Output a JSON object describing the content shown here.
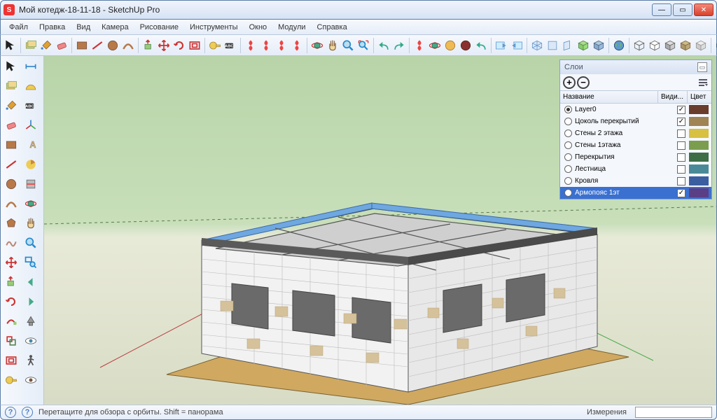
{
  "window": {
    "title": "Мой котедж-18-11-18 - SketchUp Pro"
  },
  "menu": [
    "Файл",
    "Правка",
    "Вид",
    "Камера",
    "Рисование",
    "Инструменты",
    "Окно",
    "Модули",
    "Справка"
  ],
  "layer_dropdown": {
    "current": "Layer0"
  },
  "layers_panel": {
    "title": "Слои",
    "columns": {
      "name": "Название",
      "visible": "Види...",
      "color": "Цвет"
    },
    "items": [
      {
        "name": "Layer0",
        "active": true,
        "visible": true,
        "color": "#6a3c2c"
      },
      {
        "name": "Цоколь перекрытий",
        "active": false,
        "visible": true,
        "color": "#a08454"
      },
      {
        "name": "Стены 2 этажа",
        "active": false,
        "visible": false,
        "color": "#d8c040"
      },
      {
        "name": "Стены 1этажа",
        "active": false,
        "visible": false,
        "color": "#7a9e4e"
      },
      {
        "name": "Перекрытия",
        "active": false,
        "visible": false,
        "color": "#3d6e46"
      },
      {
        "name": "Лестница",
        "active": false,
        "visible": false,
        "color": "#4a8a98"
      },
      {
        "name": "Кровля",
        "active": false,
        "visible": false,
        "color": "#3a5ea0"
      },
      {
        "name": "Армопояс 1эт",
        "active": false,
        "visible": true,
        "color": "#5a3e86",
        "selected": true
      }
    ]
  },
  "statusbar": {
    "hint": "Перетащите для обзора с орбиты.  Shift = панорама",
    "measure_label": "Измерения"
  },
  "toolbar_icons": [
    "select-arrow",
    "divider",
    "component",
    "paint-bucket",
    "eraser",
    "divider",
    "rectangle",
    "line",
    "circle",
    "arc",
    "divider",
    "push-pull",
    "move",
    "rotate",
    "offset",
    "divider",
    "measure",
    "text",
    "divider",
    "shape-red",
    "shape-red",
    "shape-red",
    "shape-red",
    "divider",
    "orbit",
    "pan",
    "zoom",
    "zoom-extents",
    "divider",
    "undo",
    "redo",
    "divider",
    "shape-red",
    "orbit",
    "golden",
    "maroon",
    "undo-green",
    "divider",
    "prev-view",
    "next-view",
    "divider",
    "iso",
    "front",
    "right",
    "box-green",
    "box-blue",
    "divider",
    "globe",
    "divider",
    "wireframe",
    "hidden",
    "shaded",
    "texture",
    "mono",
    "divider",
    "globe",
    "divider",
    "box1",
    "box2",
    "box3",
    "components",
    "divider",
    "materials",
    "divider",
    "info-icon"
  ],
  "side_icons": [
    "select-arrow",
    "component",
    "paint-bucket",
    "eraser",
    "rectangle",
    "line",
    "circle",
    "arc",
    "polygon",
    "freehand",
    "move",
    "push-pull",
    "rotate",
    "follow-me",
    "scale",
    "offset",
    "tape",
    "dimension",
    "protractor",
    "text",
    "axes",
    "3d-text",
    "pie",
    "section",
    "orbit",
    "pan",
    "zoom",
    "zoom-window",
    "prev",
    "next",
    "position-camera",
    "look",
    "walk",
    "eye"
  ]
}
